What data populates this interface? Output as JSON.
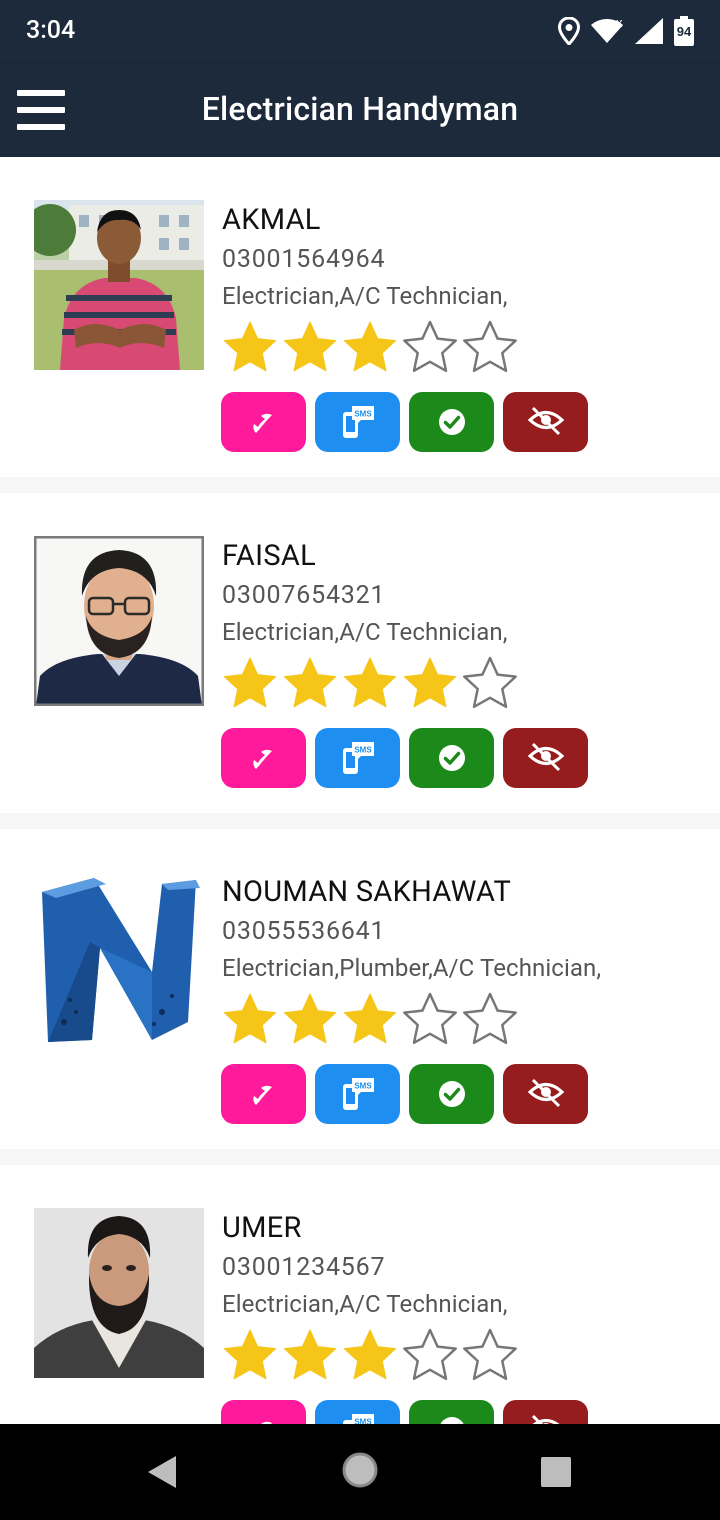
{
  "status_bar": {
    "time": "3:04",
    "battery": "94",
    "icons": [
      "location-icon",
      "wifi-icon",
      "signal-icon",
      "battery-icon"
    ]
  },
  "app_bar": {
    "title": "Electrician Handyman",
    "menu_icon": "hamburger-menu-icon"
  },
  "colors": {
    "header": "#1c2a3b",
    "star_filled": "#f5c518",
    "call": "#ff1a9c",
    "sms": "#1e8ef0",
    "approve": "#1b8a1b",
    "block": "#961d1d"
  },
  "actions": [
    "call-icon",
    "sms-icon",
    "check-icon",
    "block-eye-icon"
  ],
  "workers": [
    {
      "name": "AKMAL",
      "phone": "03001564964",
      "skills": "Electrician,A/C Technician,",
      "rating": 3,
      "max_rating": 5
    },
    {
      "name": "FAISAL",
      "phone": "03007654321",
      "skills": "Electrician,A/C Technician,",
      "rating": 4,
      "max_rating": 5
    },
    {
      "name": "NOUMAN SAKHAWAT",
      "phone": "03055536641",
      "skills": "Electrician,Plumber,A/C Technician,",
      "rating": 3,
      "max_rating": 5
    },
    {
      "name": "UMER",
      "phone": "03001234567",
      "skills": "Electrician,A/C Technician,",
      "rating": 3,
      "max_rating": 5
    }
  ],
  "nav_bar": [
    "back-icon",
    "home-icon",
    "recents-icon"
  ]
}
